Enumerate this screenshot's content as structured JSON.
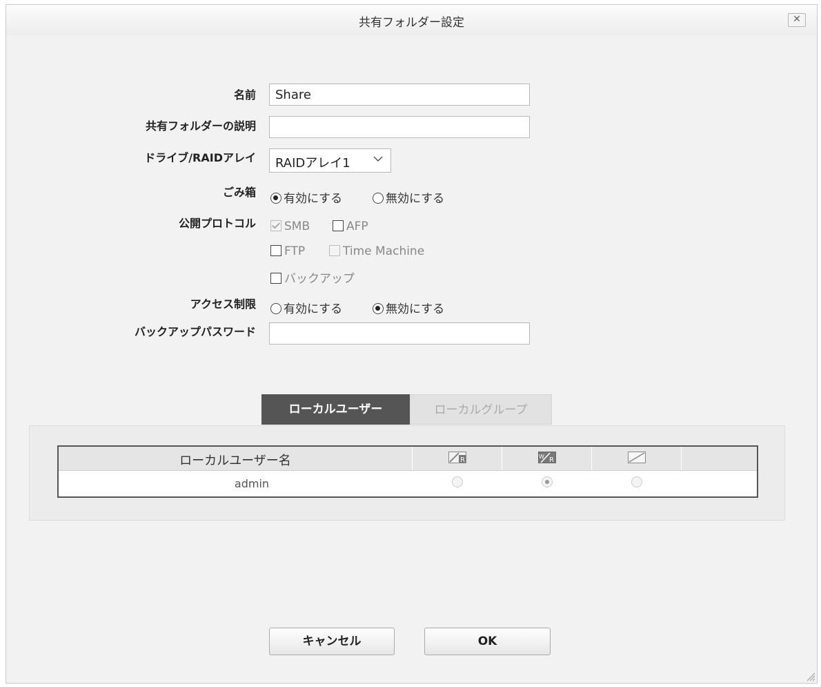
{
  "dialog": {
    "title": "共有フォルダー設定",
    "close_symbol": "✕"
  },
  "form": {
    "name_label": "名前",
    "name_value": "Share",
    "desc_label": "共有フォルダーの説明",
    "desc_value": "",
    "drive_label": "ドライブ/RAIDアレイ",
    "drive_value": "RAIDアレイ1",
    "recycle_label": "ごみ箱",
    "recycle_on": "有効にする",
    "recycle_off": "無効にする",
    "recycle_selected": "有効にする",
    "protocol_label": "公開プロトコル",
    "protocols": [
      {
        "label": "SMB",
        "checked": true,
        "disabled": true
      },
      {
        "label": "AFP",
        "checked": false,
        "disabled": false
      },
      {
        "label": "FTP",
        "checked": false,
        "disabled": false
      },
      {
        "label": "Time Machine",
        "checked": false,
        "disabled": true
      },
      {
        "label": "バックアップ",
        "checked": false,
        "disabled": false
      }
    ],
    "access_label": "アクセス制限",
    "access_on": "有効にする",
    "access_off": "無効にする",
    "access_selected": "無効にする",
    "backup_pw_label": "バックアップパスワード",
    "backup_pw_value": ""
  },
  "tabs": {
    "local_user": "ローカルユーザー",
    "local_group": "ローカルグループ",
    "active": "ローカルユーザー"
  },
  "table": {
    "header_name": "ローカルユーザー名",
    "permission_icons": [
      "read-only-icon",
      "read-write-icon",
      "no-access-icon"
    ],
    "rows": [
      {
        "name": "admin",
        "permission": "read-write"
      }
    ]
  },
  "buttons": {
    "cancel": "キャンセル",
    "ok": "OK"
  }
}
